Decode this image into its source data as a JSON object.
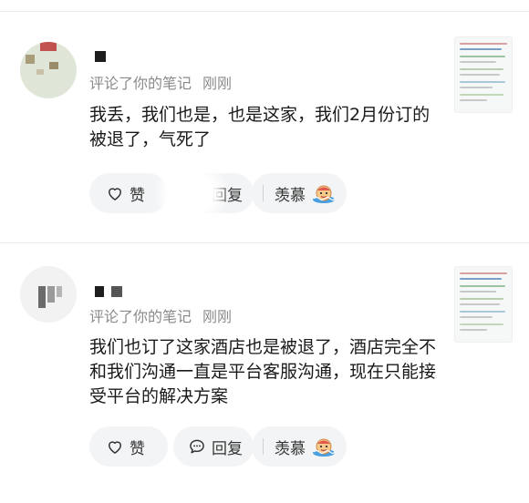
{
  "comments": [
    {
      "meta_text": "评论了你的笔记",
      "time": "刚刚",
      "text": "我丢，我们也是，也是这家，我们2月份订的被退了，气死了",
      "like_label": "赞",
      "reply_label": "回复",
      "envy_label": "羡慕"
    },
    {
      "meta_text": "评论了你的笔记",
      "time": "刚刚",
      "text": "我们也订了这家酒店也是被退了，酒店完全不和我们沟通一直是平台客服沟通，现在只能接受平台的解决方案",
      "like_label": "赞",
      "reply_label": "回复",
      "envy_label": "羡慕"
    }
  ],
  "colors": {
    "meta_gray": "#8a8a8a",
    "pill_bg": "#f3f4f6",
    "divider": "#ececec"
  },
  "icons": [
    "heart-icon",
    "chat-bubble-icon",
    "envy-emoji-icon"
  ]
}
